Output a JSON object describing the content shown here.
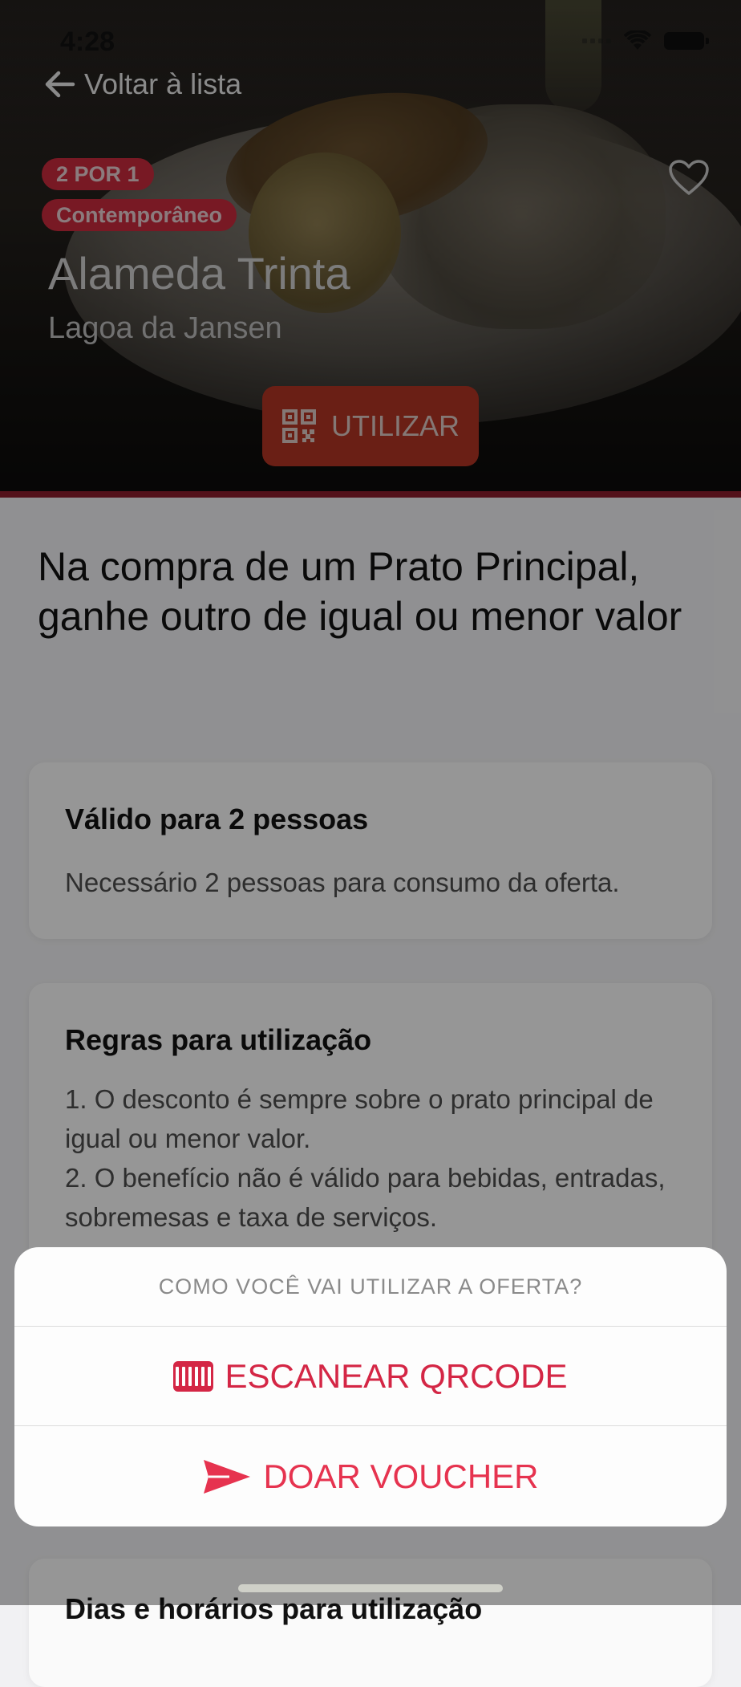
{
  "status_bar": {
    "time": "4:28"
  },
  "nav": {
    "back_label": "Voltar à lista"
  },
  "hero": {
    "tags": [
      "2 POR 1",
      "Contemporâneo"
    ],
    "restaurant_name": "Alameda Trinta",
    "location": "Lagoa da Jansen",
    "use_button_label": "UTILIZAR"
  },
  "offer": {
    "headline": "Na compra de um Prato Principal, ganhe outro de igual ou menor valor",
    "cards": [
      {
        "title": "Válido para 2 pessoas",
        "text": "Necessário 2 pessoas para consumo da oferta."
      },
      {
        "title": "Regras para utilização",
        "text": "1. O desconto é sempre sobre o prato principal de igual ou menor valor.\n2. O benefício não é válido para bebidas, entradas, sobremesas e taxa de serviços."
      },
      {
        "title": "Dias e horários para utilização"
      }
    ]
  },
  "action_sheet": {
    "title": "COMO VOCÊ VAI UTILIZAR A OFERTA?",
    "options": [
      "ESCANEAR QRCODE",
      "DOAR VOUCHER"
    ]
  },
  "colors": {
    "accent": "#d42645",
    "hero_button": "#b13423",
    "tag": "#c82a3d"
  }
}
